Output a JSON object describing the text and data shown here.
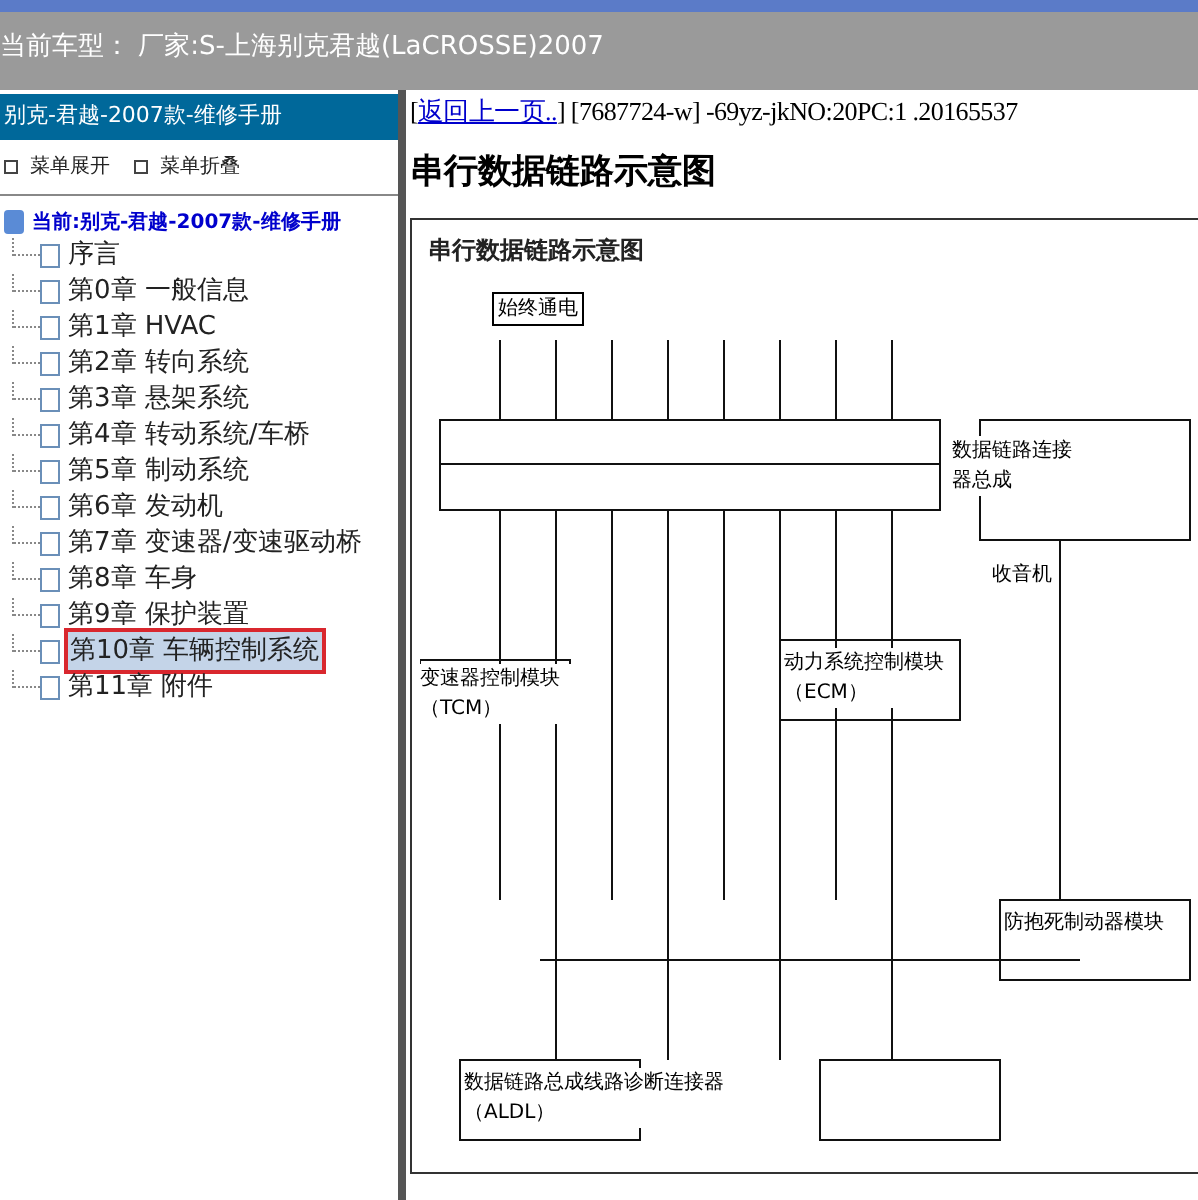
{
  "header": {
    "title": "当前车型： 厂家:S-上海别克君越(LaCROSSE)2007"
  },
  "sidebar": {
    "title": "别克-君越-2007款-维修手册",
    "actions": [
      "菜单展开",
      "菜单折叠"
    ],
    "tree": {
      "label": "当前:别克-君越-2007款-维修手册",
      "children": [
        {
          "label": "序言",
          "selected": false
        },
        {
          "label": "第0章 一般信息",
          "selected": false
        },
        {
          "label": "第1章 HVAC",
          "selected": false
        },
        {
          "label": "第2章 转向系统",
          "selected": false
        },
        {
          "label": "第3章 悬架系统",
          "selected": false
        },
        {
          "label": "第4章 转动系统/车桥",
          "selected": false
        },
        {
          "label": "第5章 制动系统",
          "selected": false
        },
        {
          "label": "第6章 发动机",
          "selected": false
        },
        {
          "label": "第7章 变速器/变速驱动桥",
          "selected": false
        },
        {
          "label": "第8章 车身",
          "selected": false
        },
        {
          "label": "第9章 保护装置",
          "selected": false
        },
        {
          "label": "第10章 车辆控制系统",
          "selected": true
        },
        {
          "label": "第11章 附件",
          "selected": false
        }
      ]
    }
  },
  "content": {
    "open_bracket": "[",
    "back_link": "返回上一页..",
    "breadcrumb": "] [7687724-w] -69yz-jkNO:20PC:1 .20165537",
    "heading": "串行数据链路示意图",
    "diagram": {
      "title": "串行数据链路示意图",
      "labels": [
        "始终通电",
        "数据链路连接器总成",
        "收音机",
        "变速器控制模块（TCM）",
        "动力系统控制模块（ECM）",
        "防抱死制动器模块",
        "数据链路总成线路诊断连接器（ALDL）"
      ]
    }
  }
}
